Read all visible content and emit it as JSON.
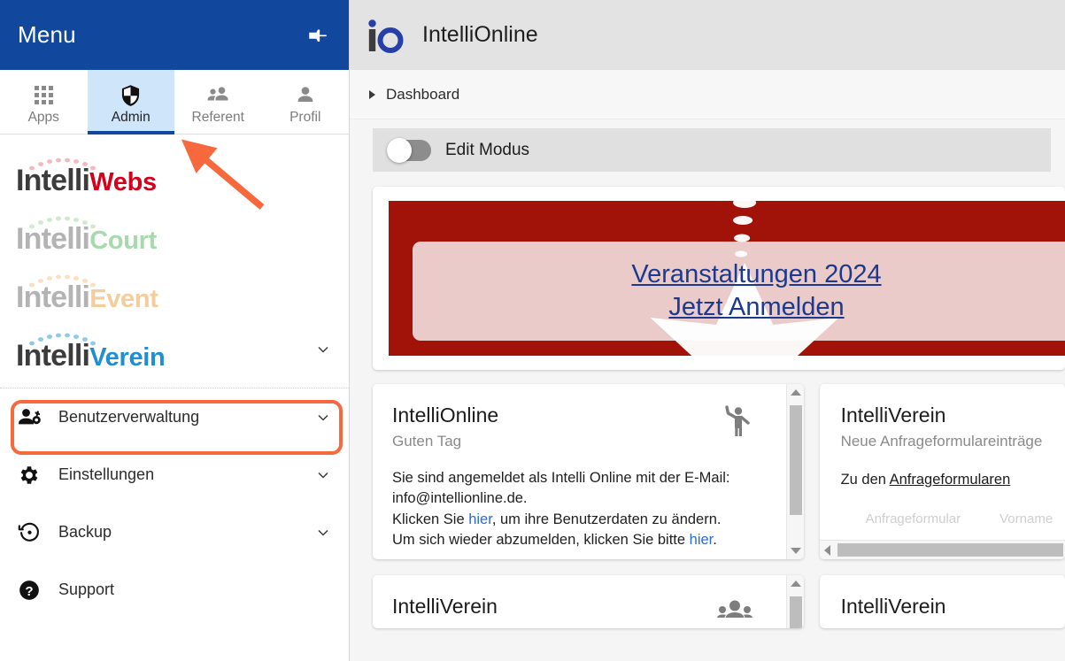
{
  "sidebar": {
    "header": {
      "title": "Menu",
      "pin_icon": "pin-icon"
    },
    "tabs": [
      {
        "label": "Apps",
        "icon": "apps-grid-icon",
        "active": false
      },
      {
        "label": "Admin",
        "icon": "shield-icon",
        "active": true
      },
      {
        "label": "Referent",
        "icon": "people-icon",
        "active": false
      },
      {
        "label": "Profil",
        "icon": "person-icon",
        "active": false
      }
    ],
    "products": [
      {
        "prefix": "Intelli",
        "suffix": "Webs",
        "prefix_color": "#3c3c3c",
        "suffix_color": "#d5001c",
        "arc_color": "#f3b9c2",
        "has_chevron": false
      },
      {
        "prefix": "Intelli",
        "suffix": "Court",
        "prefix_color": "#b3b3b3",
        "suffix_color": "#a8d9ad",
        "arc_color": "#cfeacf",
        "has_chevron": false
      },
      {
        "prefix": "Intelli",
        "suffix": "Event",
        "prefix_color": "#b3b3b3",
        "suffix_color": "#f5cc9b",
        "arc_color": "#fbe0c0",
        "has_chevron": false
      },
      {
        "prefix": "Intelli",
        "suffix": "Verein",
        "prefix_color": "#3c3c3c",
        "suffix_color": "#1e8fd5",
        "arc_color": "#8ecbeb",
        "has_chevron": true
      }
    ],
    "nav_items": [
      {
        "label": "Benutzerverwaltung",
        "icon": "user-settings-icon",
        "has_chevron": true,
        "highlighted": true
      },
      {
        "label": "Einstellungen",
        "icon": "gear-icon",
        "has_chevron": true,
        "highlighted": false
      },
      {
        "label": "Backup",
        "icon": "restore-icon",
        "has_chevron": true,
        "highlighted": false
      },
      {
        "label": "Support",
        "icon": "help-icon",
        "has_chevron": false,
        "highlighted": false
      }
    ],
    "annotation": {
      "arrow_color": "#f7693c",
      "box_color": "#f7693c"
    }
  },
  "main": {
    "app_header": {
      "logo_i": "i",
      "logo_o": "o",
      "title": "IntelliOnline"
    },
    "breadcrumb": {
      "label": "Dashboard",
      "icon": "triangle-right-icon"
    },
    "edit_bar": {
      "label": "Edit Modus",
      "toggle_state": "off"
    },
    "banner": {
      "background_color": "#a11209",
      "link_line1": "Veranstaltungen 2024",
      "link_line2": "Jetzt Anmelden"
    },
    "cards": [
      {
        "title": "IntelliOnline",
        "subtitle": "Guten Tag",
        "icon": "waving-person-icon",
        "body_line1": "Sie sind angemeldet als Intelli Online mit der E-Mail:",
        "body_line2": "info@intellionline.de.",
        "body_line3_pre": "Klicken Sie ",
        "body_line3_link": "hier",
        "body_line3_post": ", um ihre Benutzerdaten zu ändern.",
        "body_line4_pre": "Um sich wieder abzumelden, klicken Sie bitte ",
        "body_line4_link": "hier",
        "body_line4_post": ".",
        "scrollbar": "vertical"
      },
      {
        "title": "IntelliVerein",
        "subtitle": "Neue Anfrageformulareinträge",
        "link_pre": "Zu den ",
        "link_text": "Anfrageformularen",
        "table_header_1": "Anfrageformular",
        "table_header_2": "Vorname",
        "scrollbar": "horizontal"
      },
      {
        "title": "IntelliVerein",
        "icon": "people-group-icon",
        "scrollbar": "vertical"
      },
      {
        "title": "IntelliVerein"
      }
    ]
  }
}
